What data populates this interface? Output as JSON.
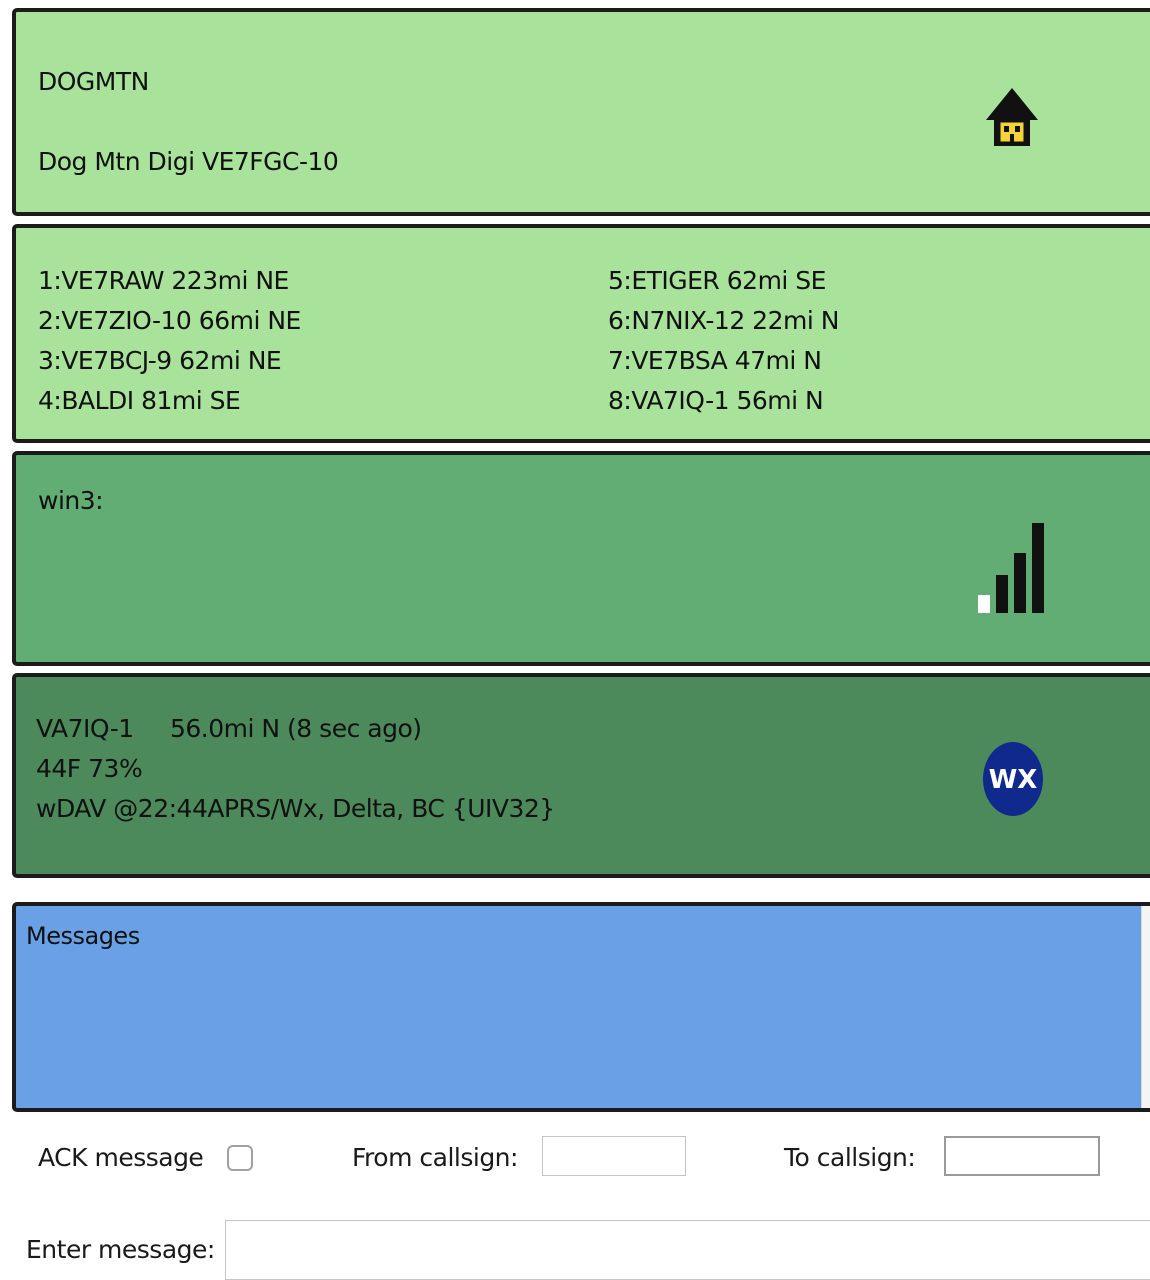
{
  "station": {
    "id": "DOGMTN",
    "description": "Dog Mtn Digi VE7FGC-10",
    "icon": "house-icon"
  },
  "nearby": {
    "left": [
      "1:VE7RAW 223mi NE",
      "2:VE7ZIO-10 66mi NE",
      "3:VE7BCJ-9 62mi NE",
      "4:BALDI 81mi SE"
    ],
    "right": [
      "5:ETIGER 62mi SE",
      "6:N7NIX-12 22mi N",
      "7:VE7BSA 47mi N",
      "8:VA7IQ-1 56mi N"
    ]
  },
  "win3": {
    "label": "win3:",
    "icon": "signal-strength-icon"
  },
  "weather": {
    "callsign": "VA7IQ-1",
    "distance": "56.0mi N (8 sec ago)",
    "reading": "44F 73%",
    "comment": "wDAV @22:44APRS/Wx, Delta, BC {UIV32}",
    "icon": "wx-icon"
  },
  "messages": {
    "title": "Messages"
  },
  "form": {
    "ack_label": "ACK message",
    "from_label": "From callsign:",
    "from_value": "",
    "to_label": "To callsign:",
    "to_value": "",
    "enter_label": "Enter message:",
    "message_value": ""
  },
  "colors": {
    "light_green": "#a8e29b",
    "mid_green": "#62ad73",
    "dark_green": "#4c8a5c",
    "message_blue": "#6aa0e6"
  }
}
